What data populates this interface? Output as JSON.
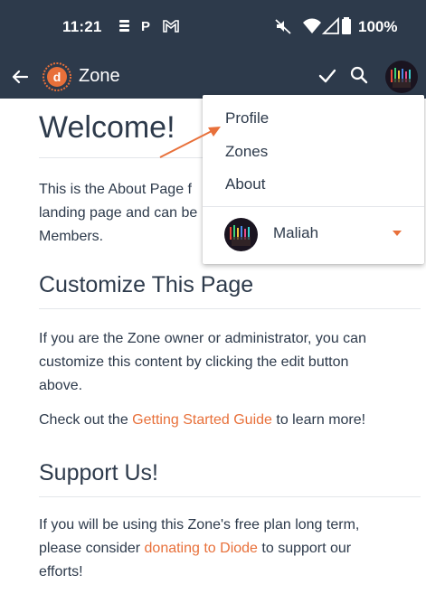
{
  "status_bar": {
    "time": "11:21",
    "p_label": "P",
    "battery": "100%",
    "icons": [
      "sim-stack-icon",
      "p-icon",
      "gmail-icon",
      "mute-icon",
      "wifi-icon",
      "signal-icon",
      "battery-icon"
    ]
  },
  "app_bar": {
    "title": "Zone",
    "logo_letter": "d",
    "icons": [
      "back-arrow-icon",
      "zone-logo-icon",
      "check-icon",
      "search-icon",
      "avatar"
    ],
    "accent": "#e8703a",
    "background": "#2d3a4b"
  },
  "content": {
    "heading": "Welcome!",
    "intro": "This is the About Page f\nlanding page and can be\nMembers.",
    "customize_heading": "Customize This Page",
    "customize_text": "If you are the Zone owner or administrator, you can customize this content by clicking the edit button above.",
    "guide_prefix": "Check out the ",
    "guide_link": "Getting Started Guide",
    "guide_suffix": " to learn more!",
    "support_heading": "Support Us!",
    "support_prefix": "If you will be using this Zone's free plan long term, please consider ",
    "support_link": "donating to Diode",
    "support_suffix": " to support our efforts!"
  },
  "menu": {
    "items": [
      {
        "label": "Profile"
      },
      {
        "label": "Zones"
      },
      {
        "label": "About"
      }
    ],
    "user_name": "Maliah"
  },
  "colors": {
    "text": "#2d3a4b",
    "link": "#e8703a",
    "annotation_arrow": "#e8703a"
  }
}
